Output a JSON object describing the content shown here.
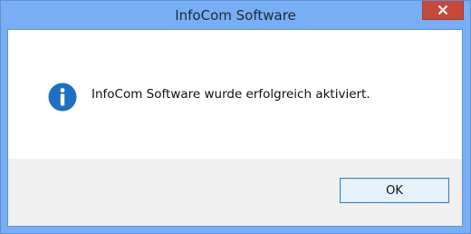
{
  "window": {
    "title": "InfoCom Software",
    "close_icon": "close-icon",
    "frame_color": "#78aef3",
    "close_color": "#c7483d"
  },
  "content": {
    "icon": "info-icon",
    "icon_color": "#1f6fc2",
    "message": "InfoCom Software wurde erfolgreich aktiviert."
  },
  "footer": {
    "ok_label": "OK"
  }
}
